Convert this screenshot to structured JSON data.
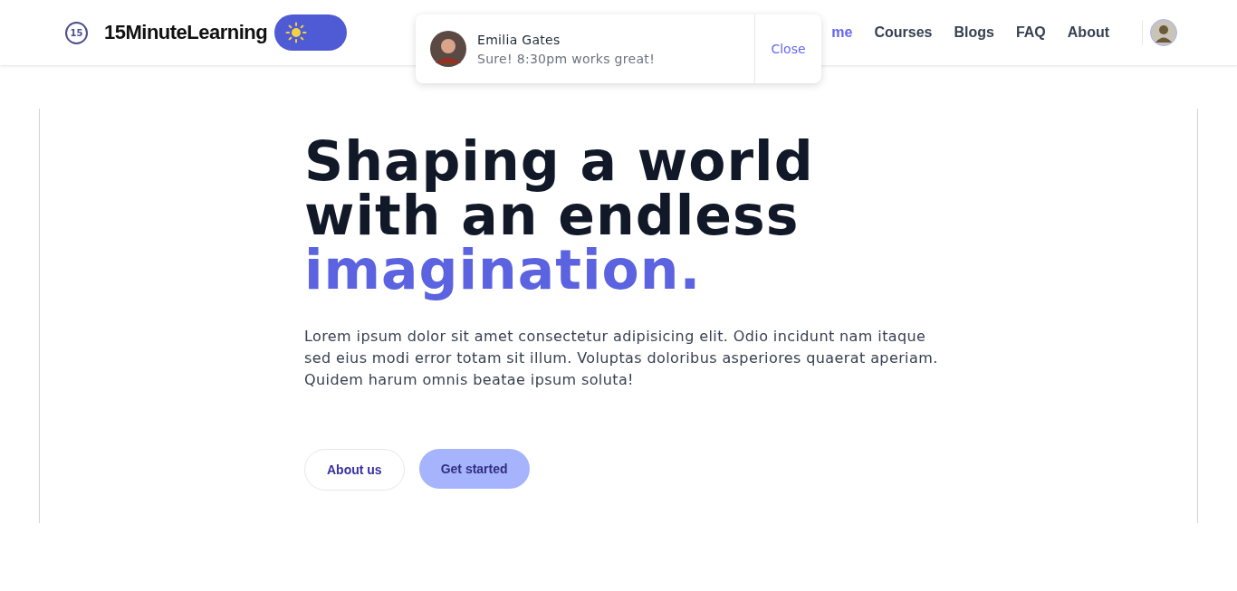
{
  "brand": {
    "name": "15MinuteLearning",
    "logo_text": "15"
  },
  "theme_toggle": {
    "on": false
  },
  "nav": [
    {
      "label": "me",
      "selected": true
    },
    {
      "label": "Courses",
      "selected": false
    },
    {
      "label": "Blogs",
      "selected": false
    },
    {
      "label": "FAQ",
      "selected": false
    },
    {
      "label": "About",
      "selected": false
    }
  ],
  "notification": {
    "name": "Emilia Gates",
    "message": "Sure! 8:30pm works great!",
    "action": "Close"
  },
  "hero": {
    "title": "Shaping a world with an endless",
    "highlight": "imagination.",
    "text": "Lorem ipsum dolor sit amet consectetur adipisicing elit. Odio incidunt nam itaque sed eius modi error totam sit illum. Voluptas doloribus asperiores quaerat aperiam. Quidem harum omnis beatae ipsum soluta!",
    "buttons": [
      {
        "label": "About us",
        "kind": "outline"
      },
      {
        "label": "Get started",
        "kind": "filled"
      }
    ]
  }
}
